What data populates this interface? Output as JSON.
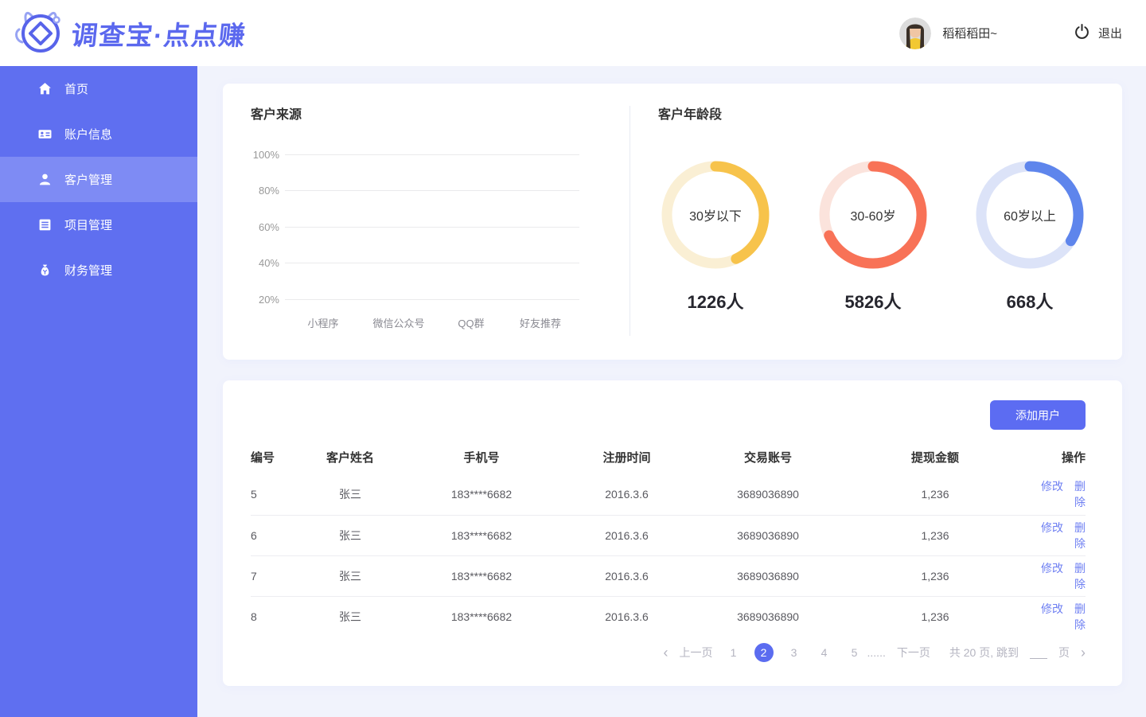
{
  "header": {
    "logo_text": "调查宝·点点赚",
    "username": "稻稻稻田~",
    "logout_label": "退出"
  },
  "sidebar": {
    "items": [
      {
        "label": "首页",
        "icon": "home-icon",
        "active": false
      },
      {
        "label": "账户信息",
        "icon": "id-card-icon",
        "active": false
      },
      {
        "label": "客户管理",
        "icon": "user-icon",
        "active": true
      },
      {
        "label": "项目管理",
        "icon": "project-list-icon",
        "active": false
      },
      {
        "label": "财务管理",
        "icon": "money-bag-icon",
        "active": false
      }
    ]
  },
  "chart_data": [
    {
      "type": "bar",
      "title": "客户来源",
      "categories": [
        "小程序",
        "微信公众号",
        "QQ群",
        "好友推荐"
      ],
      "values": [],
      "y_ticks": [
        "100%",
        "80%",
        "60%",
        "40%",
        "20%"
      ],
      "ylim": [
        0,
        100
      ],
      "grid": true,
      "note": "axes and gridlines shown with no bars rendered"
    },
    {
      "type": "donut-set",
      "title": "客户年龄段",
      "rings": [
        {
          "label": "30岁以下",
          "count": 1226,
          "count_label": "1226人",
          "arc_percent": 43,
          "color": "#F7C34B",
          "track_color": "#FAEFD4"
        },
        {
          "label": "30-60岁",
          "count": 5826,
          "count_label": "5826人",
          "arc_percent": 68,
          "color": "#F87257",
          "track_color": "#FBE3DC"
        },
        {
          "label": "60岁以上",
          "count": 668,
          "count_label": "668人",
          "arc_percent": 34,
          "color": "#5E85EC",
          "track_color": "#DCE3F8"
        }
      ]
    }
  ],
  "table": {
    "add_button_label": "添加用户",
    "headers": [
      "编号",
      "客户姓名",
      "手机号",
      "注册时间",
      "交易账号",
      "提现金额",
      "操作"
    ],
    "rows": [
      {
        "id": "5",
        "name": "张三",
        "phone": "183****6682",
        "reg_date": "2016.3.6",
        "account": "3689036890",
        "amount": "1,236",
        "actions": [
          "修改",
          "删除"
        ]
      },
      {
        "id": "6",
        "name": "张三",
        "phone": "183****6682",
        "reg_date": "2016.3.6",
        "account": "3689036890",
        "amount": "1,236",
        "actions": [
          "修改",
          "删除"
        ]
      },
      {
        "id": "7",
        "name": "张三",
        "phone": "183****6682",
        "reg_date": "2016.3.6",
        "account": "3689036890",
        "amount": "1,236",
        "actions": [
          "修改",
          "删除"
        ]
      },
      {
        "id": "8",
        "name": "张三",
        "phone": "183****6682",
        "reg_date": "2016.3.6",
        "account": "3689036890",
        "amount": "1,236",
        "actions": [
          "修改",
          "删除"
        ]
      }
    ]
  },
  "pagination": {
    "prev_arrow": "‹",
    "prev_label": "上一页",
    "pages": [
      "1",
      "2",
      "3",
      "4",
      "5"
    ],
    "active_page": "2",
    "ellipsis": "......",
    "next_label": "下一页",
    "total_text": "共 20 页, 跳到",
    "jump_suffix": "页",
    "next_arrow": "›"
  },
  "colors": {
    "accent": "#5B6CF0",
    "sidebar_bg": "#5F6FF0",
    "sidebar_active_bg": "#7E8BF4",
    "page_bg": "#F1F3FC",
    "card_bg": "#FFFFFF",
    "logo_color": "#5B68EE",
    "link_color": "#6E7FF2",
    "grid_line": "#EAEAEC",
    "ring_yellow": "#F7C34B",
    "ring_orange": "#F87257",
    "ring_blue": "#5E85EC"
  }
}
